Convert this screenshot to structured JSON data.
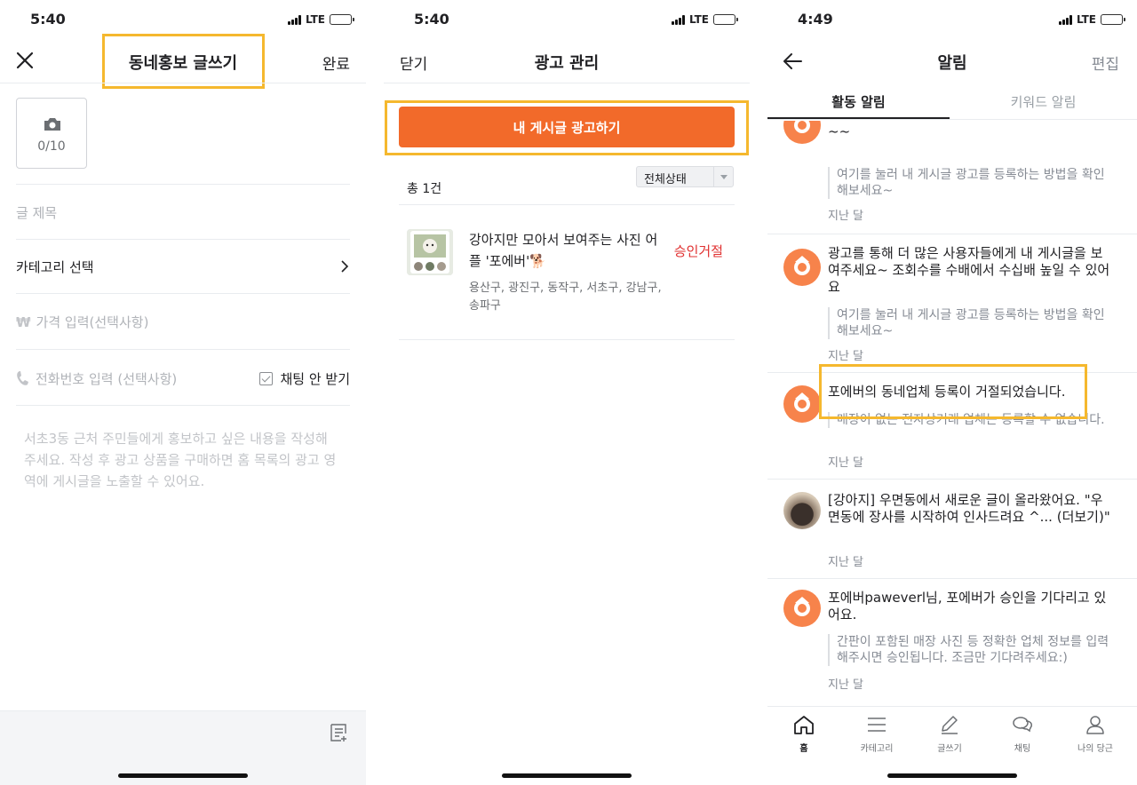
{
  "screen1": {
    "status": {
      "time": "5:40",
      "network": "LTE"
    },
    "title": "동네홍보 글쓰기",
    "done_label": "완료",
    "photo_count": "0/10",
    "title_placeholder": "글 제목",
    "category_label": "카테고리 선택",
    "price_placeholder": "가격 입력(선택사항)",
    "price_symbol": "₩",
    "phone_placeholder": "전화번호 입력 (선택사항)",
    "chat_option_label": "채팅 안 받기",
    "body_placeholder": "서초3동 근처 주민들에게 홍보하고 싶은 내용을 작성해주세요. 작성 후 광고 상품을 구매하면 홈 목록의 광고 영역에 게시글을 노출할 수 있어요."
  },
  "screen2": {
    "status": {
      "time": "5:40",
      "network": "LTE"
    },
    "close_label": "닫기",
    "title": "광고 관리",
    "cta_label": "내 게시글 광고하기",
    "total_label": "총 1건",
    "filter_label": "전체상태",
    "ad": {
      "title": "강아지만 모아서 보여주는 사진 어플 '포에버'🐕",
      "status": "승인거절",
      "regions": "용산구, 광진구, 동작구, 서초구, 강남구, 송파구"
    }
  },
  "screen3": {
    "status": {
      "time": "4:49",
      "network": "LTE"
    },
    "title": "알림",
    "edit_label": "편집",
    "tabs": [
      {
        "label": "활동 알림",
        "active": true
      },
      {
        "label": "키워드 알림",
        "active": false
      }
    ],
    "notifications": [
      {
        "message": "해 더 많은 사용자들에게 내 게시글을 보여주세요~~",
        "quote": "여기를 눌러 내 게시글 광고를 등록하는 방법을 확인해보세요~",
        "time": "지난 달",
        "icon": "karrot-icon"
      },
      {
        "message": "광고를 통해 더 많은 사용자들에게 내 게시글을 보여주세요~ 조회수를 수배에서 수십배 높일 수 있어요",
        "quote": "여기를 눌러 내 게시글 광고를 등록하는 방법을 확인해보세요~",
        "time": "지난 달",
        "icon": "karrot-icon"
      },
      {
        "message": "포에버의 동네업체 등록이 거절되었습니다.",
        "quote": "매장이 없는 전자상거래 업체는 등록할 수 없습니다.",
        "time": "지난 달",
        "icon": "karrot-icon"
      },
      {
        "message": "[강아지] 우면동에서 새로운 글이 올라왔어요. \"우면동에 장사를 시작하여 인사드려요 ^... (더보기)\"",
        "quote": "",
        "time": "지난 달",
        "icon": "dog-avatar"
      },
      {
        "message": "포에버paweverl님, 포에버가 승인을 기다리고 있어요.",
        "quote": "간판이 포함된 매장 사진 등 정확한 업체 정보를 입력해주시면 승인됩니다. 조금만 기다려주세요:)",
        "time": "지난 달",
        "icon": "karrot-icon"
      }
    ],
    "tabbar": [
      {
        "label": "홈",
        "icon": "home-icon",
        "active": true
      },
      {
        "label": "카테고리",
        "icon": "menu-icon",
        "active": false
      },
      {
        "label": "글쓰기",
        "icon": "pencil-icon",
        "active": false
      },
      {
        "label": "채팅",
        "icon": "chat-icon",
        "active": false
      },
      {
        "label": "나의 당근",
        "icon": "person-icon",
        "active": false
      }
    ]
  },
  "colors": {
    "accent": "#f26a2a",
    "highlight": "#f5b82e",
    "rejected": "#e03131"
  }
}
